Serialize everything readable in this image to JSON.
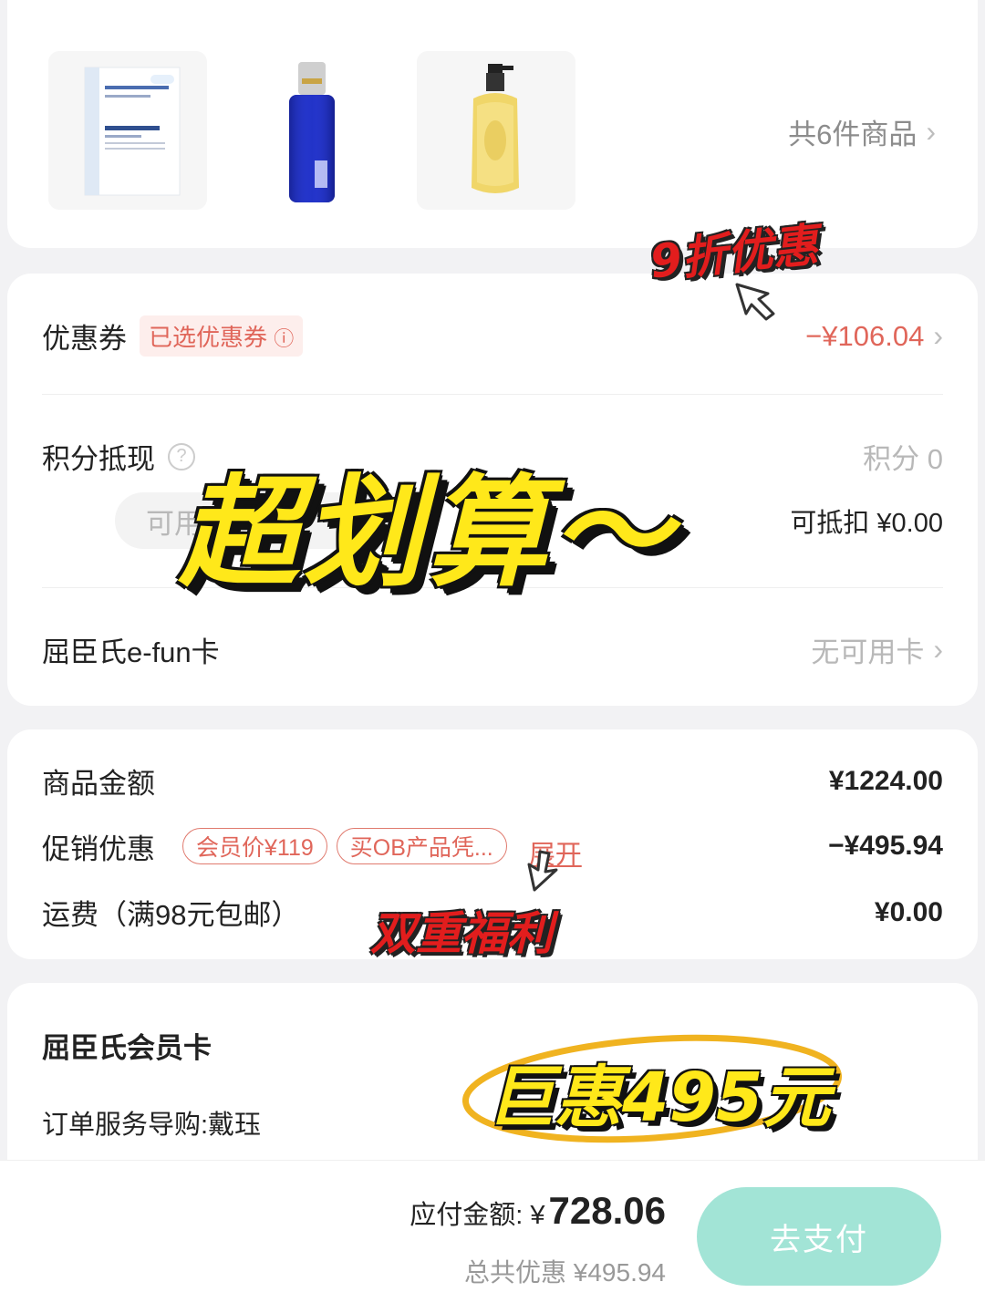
{
  "products": {
    "thumbs": [
      {
        "icon": "mask-box-product"
      },
      {
        "icon": "blue-serum-bottle"
      },
      {
        "icon": "gold-shampoo-bottle"
      }
    ],
    "count_label": "共6件商品"
  },
  "discount_card": {
    "coupon_label": "优惠券",
    "coupon_tag": "已选优惠券",
    "coupon_amount": "−¥106.04",
    "points_label": "积分抵现",
    "points_value_label": "积分 0",
    "points_usable": "可用",
    "points_deductible": "可抵扣 ¥0.00",
    "efun_label": "屈臣氏e-fun卡",
    "efun_value": "无可用卡"
  },
  "summary": {
    "goods_label": "商品金额",
    "goods_value": "¥1224.00",
    "promo_label": "促销优惠",
    "promo_pills": [
      "会员价¥119",
      "买OB产品凭..."
    ],
    "promo_expand": "展开",
    "promo_value": "−¥495.94",
    "shipping_label": "运费（满98元包邮）",
    "shipping_value": "¥0.00"
  },
  "member": {
    "title": "屈臣氏会员卡",
    "guide": "订单服务导购:戴珏"
  },
  "footer": {
    "payable_label": "应付金额: ¥",
    "payable_value": "728.06",
    "total_discount": "总共优惠 ¥495.94",
    "pay_button": "去支付"
  },
  "overlays": {
    "discount_note": "9折优惠",
    "headline": "超划算～",
    "double_benefit": "双重福利",
    "big_saving": "巨惠495元"
  },
  "colors": {
    "accent_red": "#e0665a",
    "pay_button": "#a2e4d6",
    "sticker_yellow": "#ffe81a",
    "sticker_red": "#e21d1d"
  }
}
